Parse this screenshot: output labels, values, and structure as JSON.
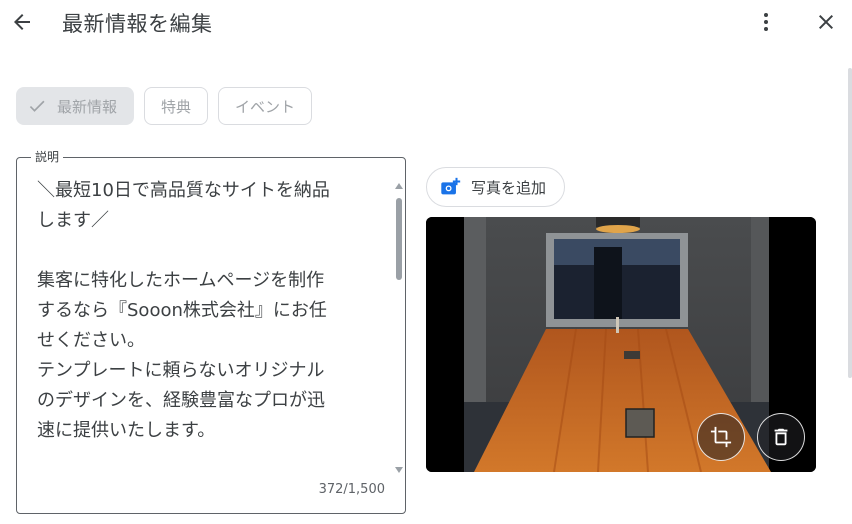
{
  "header": {
    "title": "最新情報を編集"
  },
  "chips": [
    {
      "label": "最新情報",
      "selected": true
    },
    {
      "label": "特典",
      "selected": false
    },
    {
      "label": "イベント",
      "selected": false
    }
  ],
  "description": {
    "label": "説明",
    "text": "＼最短10日で高品質なサイトを納品\nします／\n\n集客に特化したホームページを制作\nするなら『Sooon株式会社』にお任\nせください。\nテンプレートに頼らないオリジナル\nのデザインを、経験豊富なプロが迅\n速に提供いたします。",
    "counter": "372/1,500"
  },
  "media": {
    "add_photo_label": "写真を追加"
  },
  "icons": [
    "back-arrow-icon",
    "more-vert-icon",
    "close-icon",
    "check-icon",
    "add-photo-icon",
    "crop-icon",
    "delete-icon"
  ],
  "colors": {
    "accent": "#1a73e8",
    "chip_selected_bg": "#e3e5e8"
  }
}
